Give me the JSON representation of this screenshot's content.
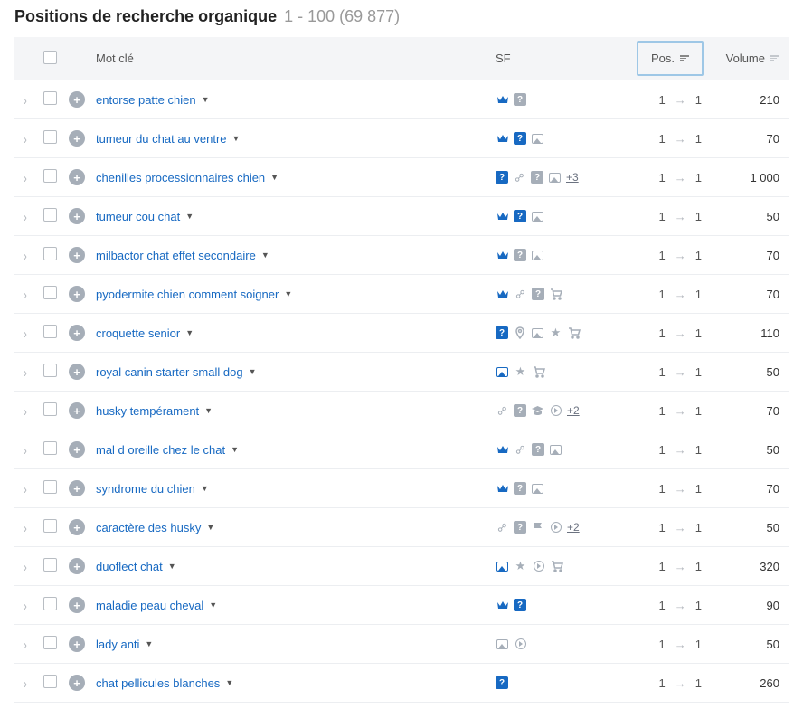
{
  "header": {
    "title": "Positions de recherche organique",
    "range": "1 - 100 (69 877)"
  },
  "table": {
    "headers": {
      "keyword": "Mot clé",
      "sf": "SF",
      "pos": "Pos.",
      "volume": "Volume"
    },
    "rows": [
      {
        "keyword": "entorse patte chien",
        "sf": [
          "crown",
          "qgrey"
        ],
        "pos_from": "1",
        "pos_to": "1",
        "volume": "210"
      },
      {
        "keyword": "tumeur du chat au ventre",
        "sf": [
          "crown",
          "qblue",
          "img"
        ],
        "pos_from": "1",
        "pos_to": "1",
        "volume": "70"
      },
      {
        "keyword": "chenilles processionnaires chien",
        "sf": [
          "qblue",
          "link",
          "qgrey",
          "img"
        ],
        "more": "+3",
        "pos_from": "1",
        "pos_to": "1",
        "volume": "1 000"
      },
      {
        "keyword": "tumeur cou chat",
        "sf": [
          "crown",
          "qblue",
          "img"
        ],
        "pos_from": "1",
        "pos_to": "1",
        "volume": "50"
      },
      {
        "keyword": "milbactor chat effet secondaire",
        "sf": [
          "crown",
          "qgrey",
          "img"
        ],
        "pos_from": "1",
        "pos_to": "1",
        "volume": "70"
      },
      {
        "keyword": "pyodermite chien comment soigner",
        "sf": [
          "crown",
          "link",
          "qgrey",
          "cart"
        ],
        "pos_from": "1",
        "pos_to": "1",
        "volume": "70"
      },
      {
        "keyword": "croquette senior",
        "sf": [
          "qblue",
          "pin",
          "img",
          "star",
          "cart"
        ],
        "pos_from": "1",
        "pos_to": "1",
        "volume": "110"
      },
      {
        "keyword": "royal canin starter small dog",
        "sf": [
          "imgblue",
          "star",
          "cart"
        ],
        "pos_from": "1",
        "pos_to": "1",
        "volume": "50"
      },
      {
        "keyword": "husky tempérament",
        "sf": [
          "link",
          "qgrey",
          "grad",
          "play"
        ],
        "more": "+2",
        "pos_from": "1",
        "pos_to": "1",
        "volume": "70"
      },
      {
        "keyword": "mal d oreille chez le chat",
        "sf": [
          "crown",
          "link",
          "qgrey",
          "img"
        ],
        "pos_from": "1",
        "pos_to": "1",
        "volume": "50"
      },
      {
        "keyword": "syndrome du chien",
        "sf": [
          "crown",
          "qgrey",
          "img"
        ],
        "pos_from": "1",
        "pos_to": "1",
        "volume": "70"
      },
      {
        "keyword": "caractère des husky",
        "sf": [
          "link",
          "qgrey",
          "flag",
          "play"
        ],
        "more": "+2",
        "pos_from": "1",
        "pos_to": "1",
        "volume": "50"
      },
      {
        "keyword": "duoflect chat",
        "sf": [
          "imgblue",
          "star",
          "play",
          "cart"
        ],
        "pos_from": "1",
        "pos_to": "1",
        "volume": "320"
      },
      {
        "keyword": "maladie peau cheval",
        "sf": [
          "crown",
          "qblue"
        ],
        "pos_from": "1",
        "pos_to": "1",
        "volume": "90"
      },
      {
        "keyword": "lady anti",
        "sf": [
          "img",
          "play"
        ],
        "pos_from": "1",
        "pos_to": "1",
        "volume": "50"
      },
      {
        "keyword": "chat pellicules blanches",
        "sf": [
          "qblue"
        ],
        "pos_from": "1",
        "pos_to": "1",
        "volume": "260"
      }
    ]
  }
}
